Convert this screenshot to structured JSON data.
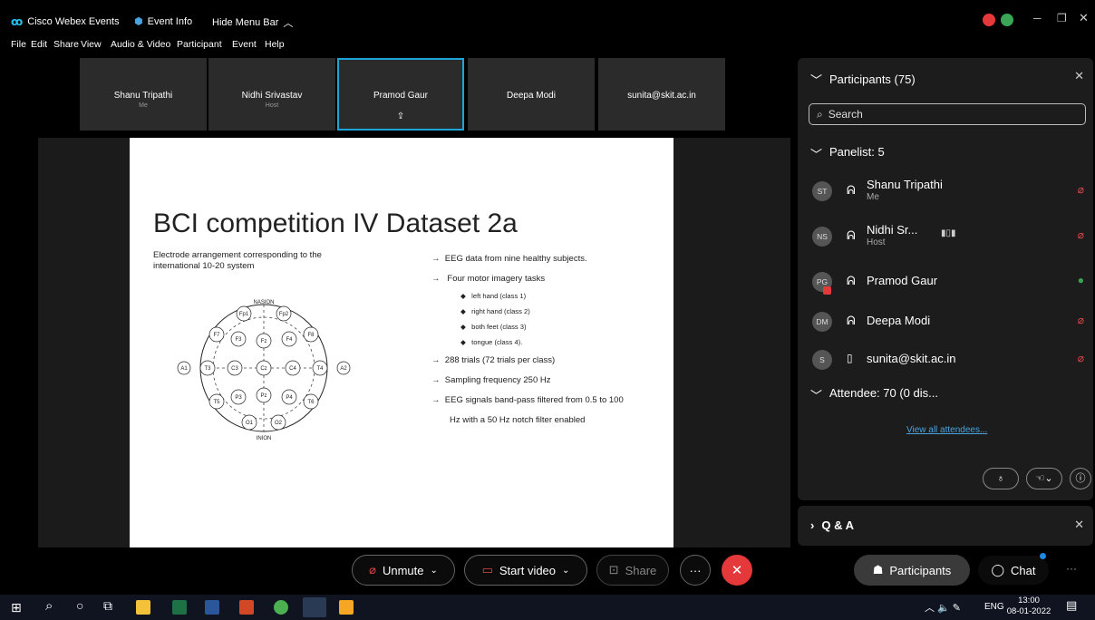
{
  "titlebar": {
    "app_name": "Cisco Webex Events",
    "event_info": "Event Info",
    "hide_menu": "Hide Menu Bar"
  },
  "menu": [
    "File",
    "Edit",
    "Share",
    "View",
    "Audio & Video",
    "Participant",
    "Event",
    "Help"
  ],
  "video_tiles": [
    {
      "name": "Shanu Tripathi",
      "sub": "Me"
    },
    {
      "name": "Nidhi Srivastav",
      "sub": "Host"
    },
    {
      "name": "Pramod Gaur",
      "sub": ""
    },
    {
      "name": "Deepa Modi",
      "sub": ""
    },
    {
      "name": "sunita@skit.ac.in",
      "sub": ""
    }
  ],
  "slide": {
    "title": "BCI competition IV Dataset 2a",
    "left_caption": "Electrode arrangement corresponding to the international 10-20 system",
    "nasion": "NASION",
    "inion": "INION",
    "electrodes": [
      "Fp1",
      "Fp2",
      "F7",
      "F3",
      "Fz",
      "F4",
      "F8",
      "A1",
      "T3",
      "C3",
      "Cz",
      "C4",
      "T4",
      "A2",
      "T5",
      "P3",
      "Pz",
      "P4",
      "T6",
      "O1",
      "O2"
    ],
    "bullets": [
      "EEG data from nine healthy subjects.",
      "Four motor imagery tasks",
      "288 trials (72 trials per class)",
      "Sampling frequency 250 Hz",
      "EEG signals band-pass filtered from 0.5 to 100",
      "Hz with a 50 Hz notch filter enabled"
    ],
    "sub_bullets": [
      "left hand (class 1)",
      "right hand (class 2)",
      "both feet (class 3)",
      "tongue (class 4)."
    ]
  },
  "panel": {
    "header": "Participants (75)",
    "search_placeholder": "Search",
    "panelist_header": "Panelist: 5",
    "participants": [
      {
        "initials": "ST",
        "name": "Shanu Tripathi",
        "role": "Me"
      },
      {
        "initials": "NS",
        "name": "Nidhi Sr...",
        "role": "Host"
      },
      {
        "initials": "PG",
        "name": "Pramod Gaur",
        "role": ""
      },
      {
        "initials": "DM",
        "name": "Deepa Modi",
        "role": ""
      },
      {
        "initials": "S",
        "name": "sunita@skit.ac.in",
        "role": ""
      }
    ],
    "attendee_header": "Attendee: 70 (0 dis...",
    "view_all": "View all attendees..."
  },
  "qa": {
    "label": "Q & A"
  },
  "controls": {
    "unmute": "Unmute",
    "start_video": "Start video",
    "share": "Share",
    "participants": "Participants",
    "chat": "Chat"
  },
  "taskbar": {
    "lang": "ENG",
    "time": "13:00",
    "date": "08-01-2022"
  },
  "colors": {
    "accent": "#1ea5d8",
    "end_call": "#e5383b",
    "mute_red": "#e04848",
    "link": "#4aa3df"
  }
}
